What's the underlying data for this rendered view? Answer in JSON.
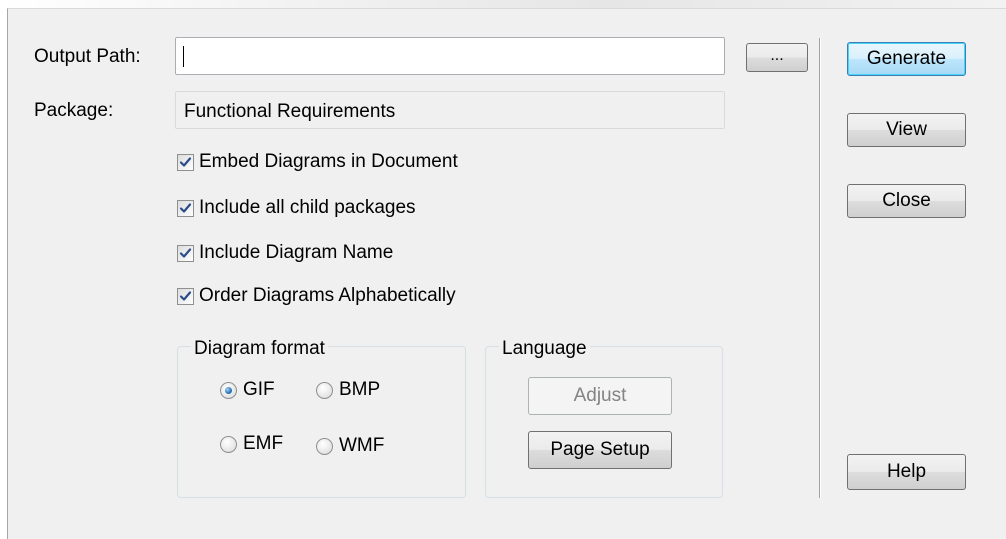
{
  "dialog": {
    "output_path_label": "Output Path:",
    "output_path_value": "",
    "browse_label": "...",
    "package_label": "Package:",
    "package_value": "Functional Requirements"
  },
  "options": [
    {
      "label": "Embed Diagrams in Document",
      "checked": true
    },
    {
      "label": "Include all child packages",
      "checked": true
    },
    {
      "label": "Include Diagram Name",
      "checked": true
    },
    {
      "label": "Order Diagrams Alphabetically",
      "checked": true
    }
  ],
  "diagram_format": {
    "title": "Diagram format",
    "selected": "GIF",
    "options": [
      "GIF",
      "BMP",
      "EMF",
      "WMF"
    ]
  },
  "language": {
    "title": "Language",
    "adjust_label": "Adjust",
    "page_setup_label": "Page Setup"
  },
  "actions": {
    "generate": "Generate",
    "view": "View",
    "close": "Close",
    "help": "Help"
  },
  "colors": {
    "dialog_bg": "#f0f0f0",
    "default_button_border": "#3c7fb1",
    "checkmark": "#2d4c8a"
  }
}
